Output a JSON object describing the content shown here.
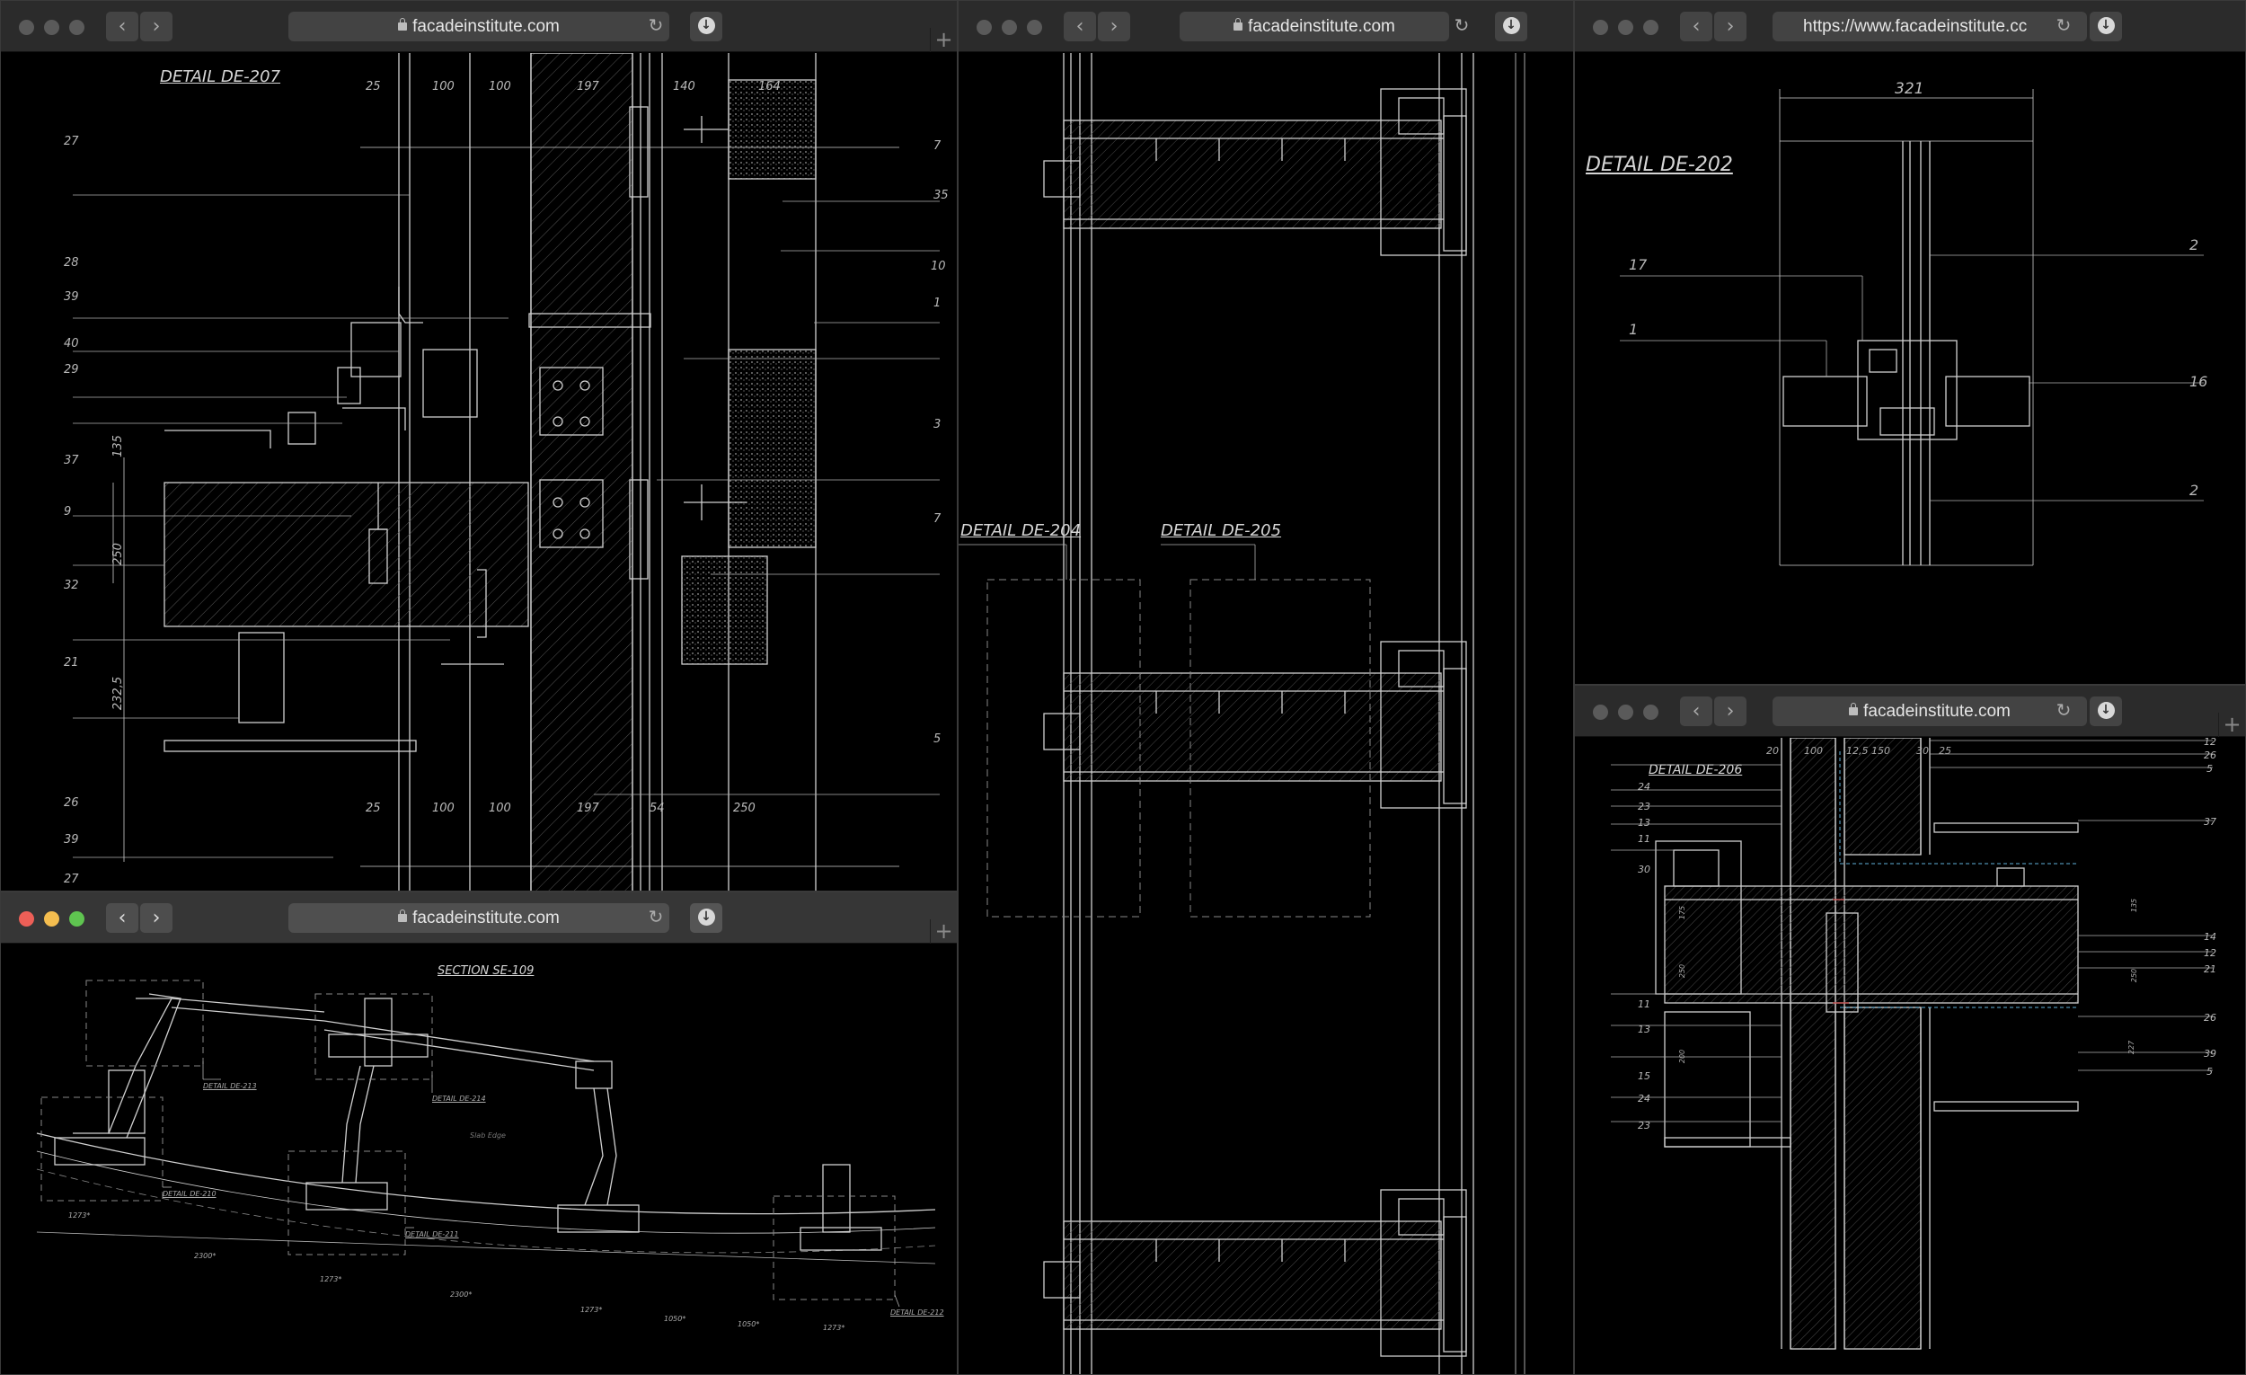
{
  "windows": {
    "w1": {
      "url": "facadeinstitute.com",
      "title": "DETAIL DE-207",
      "callouts_left": [
        "27",
        "28",
        "39",
        "40",
        "29",
        "37",
        "9",
        "32",
        "21",
        "26",
        "39",
        "27"
      ],
      "callouts_right": [
        "7",
        "35",
        "10",
        "1",
        "3",
        "7",
        "5"
      ],
      "dims_top": [
        "25",
        "100",
        "100",
        "197",
        "140",
        "164"
      ],
      "dims_bottom": [
        "25",
        "100",
        "100",
        "197",
        "54",
        "250"
      ],
      "dims_vertical": [
        "135",
        "250",
        "232,5"
      ]
    },
    "w2": {
      "url": "facadeinstitute.com",
      "title": "SECTION SE-109",
      "details": [
        "DETAIL DE-213",
        "DETAIL DE-214",
        "DETAIL DE-210",
        "DETAIL DE-211",
        "DETAIL DE-212"
      ],
      "slab_label": "Slab Edge",
      "dims": [
        "1273*",
        "2300*",
        "1273*",
        "2300*",
        "1273*",
        "1050*",
        "1050*",
        "1273*"
      ]
    },
    "w3": {
      "url": "facadeinstitute.com",
      "labels": [
        "DETAIL DE-204",
        "DETAIL DE-205"
      ]
    },
    "w4": {
      "url": "https://www.facadeinstitute.cc",
      "favicon": "FI",
      "title": "DETAIL DE-202",
      "dim_top": "321",
      "callouts": [
        "17",
        "1",
        "2",
        "16",
        "2"
      ]
    },
    "w5": {
      "url": "facadeinstitute.com",
      "title": "DETAIL DE-206",
      "dims_top": [
        "20",
        "100",
        "12,5",
        "150",
        "30",
        "25"
      ],
      "dims_vertical": [
        "175",
        "250",
        "200",
        "135",
        "250",
        "227"
      ],
      "callouts_left": [
        "24",
        "23",
        "13",
        "11",
        "30",
        "11",
        "13",
        "15",
        "24",
        "23"
      ],
      "callouts_right": [
        "12",
        "26",
        "5",
        "37",
        "14",
        "12",
        "21",
        "26",
        "39",
        "5"
      ]
    }
  },
  "icons": {
    "back": "chevron-left-icon",
    "forward": "chevron-right-icon",
    "reload": "reload-icon",
    "download": "download-icon",
    "lock": "lock-icon",
    "new_tab": "plus-icon"
  },
  "glyphs": {
    "back": "‹",
    "forward": "›",
    "reload": "↻",
    "plus": "+"
  },
  "colors": {
    "traffic_red": "#ed5f57",
    "traffic_yellow": "#f4bd4f",
    "traffic_green": "#5fc450",
    "drawing_line": "#d0d0d0",
    "canvas": "#000000"
  }
}
